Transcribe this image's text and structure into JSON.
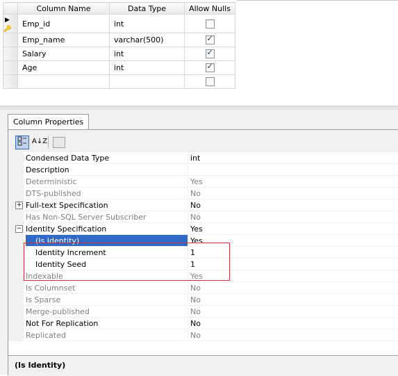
{
  "grid": {
    "headers": {
      "column_name": "Column Name",
      "data_type": "Data Type",
      "allow_nulls": "Allow Nulls"
    },
    "rows": [
      {
        "name": "Emp_id",
        "type": "int",
        "allow_nulls": false,
        "marker": "▶🔑"
      },
      {
        "name": "Emp_name",
        "type": "varchar(500)",
        "allow_nulls": true,
        "marker": ""
      },
      {
        "name": "Salary",
        "type": "int",
        "allow_nulls": true,
        "marker": ""
      },
      {
        "name": "Age",
        "type": "int",
        "allow_nulls": true,
        "marker": ""
      },
      {
        "name": "",
        "type": "",
        "allow_nulls": false,
        "marker": ""
      }
    ]
  },
  "properties": {
    "tab_label": "Column Properties",
    "toolbar": {
      "categorized_icon": "categorized-icon",
      "alphabetical_icon": "az-sort-icon",
      "alphabetical_label": "A↓Z",
      "pages_icon": "property-pages-icon"
    },
    "rows": [
      {
        "name": "Condensed Data Type",
        "value": "int",
        "readonly": false,
        "expander": ""
      },
      {
        "name": "Description",
        "value": "",
        "readonly": false,
        "expander": ""
      },
      {
        "name": "Deterministic",
        "value": "Yes",
        "readonly": true,
        "expander": ""
      },
      {
        "name": "DTS-published",
        "value": "No",
        "readonly": true,
        "expander": ""
      },
      {
        "name": "Full-text Specification",
        "value": "No",
        "readonly": false,
        "expander": "+"
      },
      {
        "name": "Has Non-SQL Server Subscriber",
        "value": "No",
        "readonly": true,
        "expander": ""
      },
      {
        "name": "Identity Specification",
        "value": "Yes",
        "readonly": false,
        "expander": "−"
      },
      {
        "name": "(Is Identity)",
        "value": "Yes",
        "readonly": false,
        "expander": "",
        "sub": true,
        "selected": true
      },
      {
        "name": "Identity Increment",
        "value": "1",
        "readonly": false,
        "expander": "",
        "sub": true
      },
      {
        "name": "Identity Seed",
        "value": "1",
        "readonly": false,
        "expander": "",
        "sub": true
      },
      {
        "name": "Indexable",
        "value": "Yes",
        "readonly": true,
        "expander": ""
      },
      {
        "name": "Is Columnset",
        "value": "No",
        "readonly": true,
        "expander": ""
      },
      {
        "name": "Is Sparse",
        "value": "No",
        "readonly": true,
        "expander": ""
      },
      {
        "name": "Merge-published",
        "value": "No",
        "readonly": true,
        "expander": ""
      },
      {
        "name": "Not For Replication",
        "value": "No",
        "readonly": false,
        "expander": ""
      },
      {
        "name": "Replicated",
        "value": "No",
        "readonly": true,
        "expander": ""
      }
    ],
    "description_title": "(Is Identity)",
    "highlight_color": "#c8323c",
    "selection_color": "#3169c6"
  }
}
